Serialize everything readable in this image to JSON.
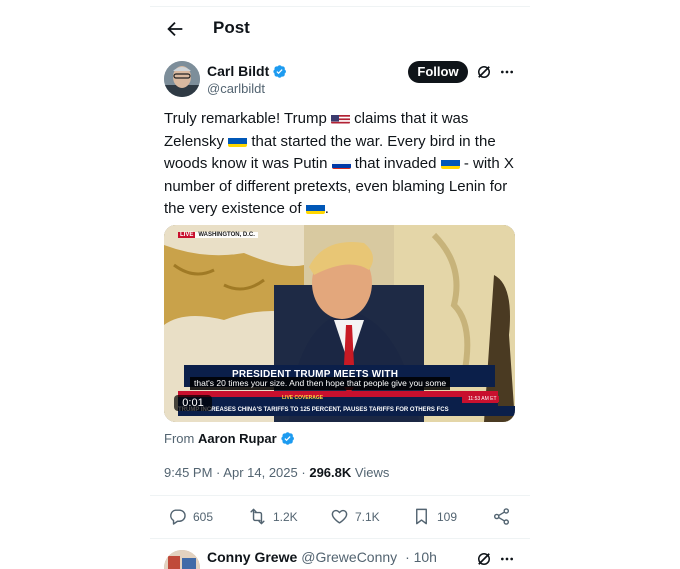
{
  "header": {
    "title": "Post"
  },
  "author": {
    "name": "Carl Bildt",
    "handle": "@carlbildt",
    "follow_label": "Follow"
  },
  "tweet": {
    "segments": [
      "Truly remarkable! Trump ",
      " claims that it was Zelensky ",
      " that started the war. Every bird in the woods know it was Putin ",
      " that invaded ",
      " - with X number of different pretexts, even blaming Lenin for the very existence of ",
      "."
    ],
    "flags": [
      "us-flag",
      "ukraine-flag",
      "russia-flag",
      "ukraine-flag",
      "ukraine-flag"
    ]
  },
  "media": {
    "live_label": "LIVE",
    "location_label": "WASHINGTON, D.C.",
    "banner_title": "PRESIDENT TRUMP MEETS WITH",
    "caption": "that's 20 times your size. And then hope that people give you some",
    "coverage_label": "LIVE COVERAGE",
    "ticker": "TRUMP INCREASES CHINA'S TARIFFS TO 125 PERCENT, PAUSES TARIFFS FOR OTHERS",
    "network": "FCS",
    "clock": "11:53 AM ET",
    "timer": "0:01"
  },
  "source": {
    "prefix": "From",
    "name": "Aaron Rupar"
  },
  "meta": {
    "time": "9:45 PM",
    "dot": "·",
    "date": "Apr 14, 2025",
    "views_count": "296.8K",
    "views_label": "Views"
  },
  "actions": {
    "replies": "605",
    "reposts": "1.2K",
    "likes": "7.1K",
    "bookmarks": "109"
  },
  "reply": {
    "name": "Conny Grewe",
    "handle": "@GreweConny",
    "time": "· 10h"
  },
  "colors": {
    "verified": "#1d9bf0",
    "text": "#0f1419",
    "secondary": "#536471",
    "follow_bg": "#0f1419"
  }
}
